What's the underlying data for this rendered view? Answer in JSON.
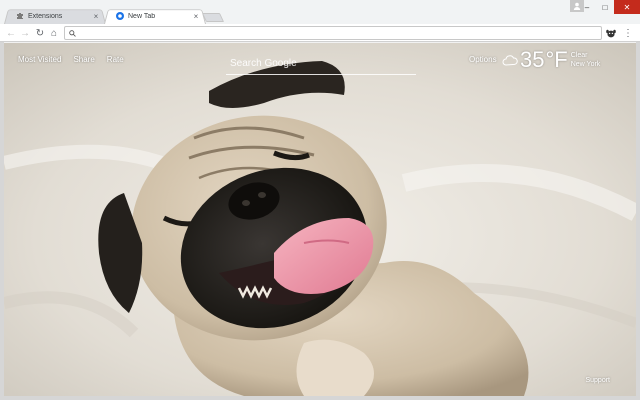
{
  "browser": {
    "tabs": [
      {
        "label": "Extensions",
        "icon": "puzzle-icon",
        "active": false
      },
      {
        "label": "New Tab",
        "icon": "new-tab-favicon",
        "active": true
      }
    ],
    "window_controls": {
      "minimize": "–",
      "maximize": "□",
      "close": "✕"
    },
    "toolbar": {
      "back": "←",
      "forward": "→",
      "reload": "↻",
      "home": "⌂",
      "address_value": "",
      "menu": "⋮"
    }
  },
  "newtab": {
    "links": [
      "Most Visited",
      "Share",
      "Rate"
    ],
    "search": {
      "placeholder": "Search Google"
    },
    "options_label": "Options",
    "weather": {
      "icon": "cloud-icon",
      "temperature": "35",
      "unit": "°F",
      "condition": "Clear",
      "location": "New York"
    },
    "support_label": "Support"
  }
}
